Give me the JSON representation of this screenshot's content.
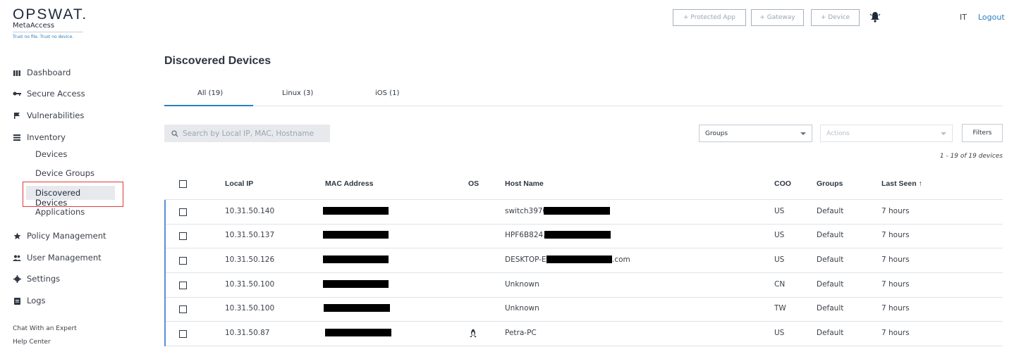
{
  "brand": {
    "name": "OPSWAT.",
    "product": "MetaAccess",
    "tagline": "Trust no file. Trust no device."
  },
  "sidebar": {
    "items": [
      {
        "label": "Dashboard",
        "icon": "bar-chart-icon"
      },
      {
        "label": "Secure Access",
        "icon": "key-icon"
      },
      {
        "label": "Vulnerabilities",
        "icon": "flag-icon"
      },
      {
        "label": "Inventory",
        "icon": "list-icon"
      },
      {
        "label": "Policy Management",
        "icon": "star-icon"
      },
      {
        "label": "User Management",
        "icon": "users-icon"
      },
      {
        "label": "Settings",
        "icon": "gear-icon"
      },
      {
        "label": "Logs",
        "icon": "clipboard-icon"
      }
    ],
    "inventory_sub": [
      "Devices",
      "Device Groups",
      "Discovered Devices",
      "Applications"
    ],
    "footer": [
      "Chat With an Expert",
      "Help Center"
    ]
  },
  "topbar": {
    "buttons": [
      "+ Protected App",
      "+ Gateway",
      "+ Device"
    ],
    "user": "IT",
    "logout": "Logout"
  },
  "page": {
    "title": "Discovered Devices",
    "tabs": [
      "All (19)",
      "Linux (3)",
      "iOS (1)"
    ],
    "search_placeholder": "Search by Local IP, MAC, Hostname",
    "groups_select": "Groups",
    "actions_select": "Actions",
    "filters_label": "Filters",
    "count_text": "1 - 19 of 19 devices"
  },
  "table": {
    "headers": [
      "Local IP",
      "MAC Address",
      "OS",
      "Host Name",
      "COO",
      "Groups",
      "Last Seen ↑"
    ],
    "rows": [
      {
        "ip": "10.31.50.140",
        "host": "switch3970",
        "host_suffix": "",
        "coo": "US",
        "group": "Default",
        "seen": "7 hours",
        "os": ""
      },
      {
        "ip": "10.31.50.137",
        "host": "HPF6B824.",
        "host_suffix": "",
        "coo": "US",
        "group": "Default",
        "seen": "7 hours",
        "os": ""
      },
      {
        "ip": "10.31.50.126",
        "host": "DESKTOP-E",
        "host_suffix": ".com",
        "coo": "US",
        "group": "Default",
        "seen": "7 hours",
        "os": ""
      },
      {
        "ip": "10.31.50.100",
        "host": "Unknown",
        "host_suffix": "",
        "coo": "CN",
        "group": "Default",
        "seen": "7 hours",
        "os": ""
      },
      {
        "ip": "10.31.50.100",
        "host": "Unknown",
        "host_suffix": "",
        "coo": "TW",
        "group": "Default",
        "seen": "7 hours",
        "os": ""
      },
      {
        "ip": "10.31.50.87",
        "host": "Petra-PC",
        "host_suffix": "",
        "coo": "US",
        "group": "Default",
        "seen": "7 hours",
        "os": "linux-icon"
      }
    ]
  },
  "colors": {
    "accent": "#2a7fc1",
    "highlight": "#e03a3a",
    "row_accent": "#5b8ed6"
  }
}
